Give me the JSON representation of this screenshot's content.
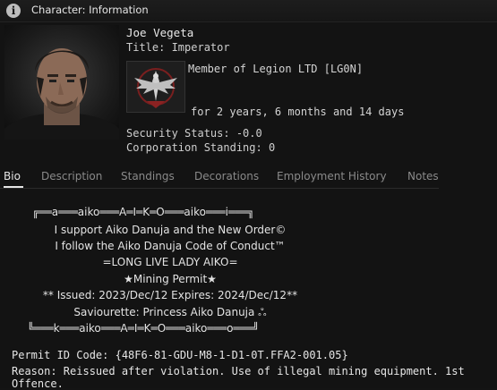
{
  "window": {
    "title": "Character: Information"
  },
  "character": {
    "name": "Joe Vegeta",
    "title": "Title: Imperator",
    "corp_member": "Member of Legion LTD [LG0N]",
    "corp_duration": "for 2 years, 6 months and 14 days",
    "security_status": "Security Status: -0.0",
    "corp_standing": "Corporation Standing: 0"
  },
  "tabs": [
    "Bio",
    "Description",
    "Standings",
    "Decorations",
    "Employment History",
    "Notes"
  ],
  "active_tab": "Bio",
  "bio": {
    "lines": [
      "╔══a═══aiko═══A═I═K═O═══aiko═══i═══╗",
      "I support Aiko Danuja and the New Order©",
      "I follow the Aiko Danuja Code of Conduct™",
      "=LONG LIVE LADY AIKO=",
      "★Mining Permit★",
      "** Issued: 2023/Dec/12 Expires: 2024/Dec/12**",
      "Saviourette: Princess Aiko Danuja ஃ",
      "╚═══k═══aiko═══A═I═K═O═══aiko═══o═══╝"
    ],
    "permit_id": "Permit ID Code: {48F6-81-GDU-M8-1-D1-0T.FFA2-001.05}",
    "reason": "Reason: Reissued after violation.  Use of illegal mining equipment. 1st Offence."
  },
  "colors": {
    "background": "#131313",
    "text": "#d6d6d6",
    "tab_inactive": "#8a8a8a",
    "tab_active": "#e6e6e6"
  },
  "icons": {
    "titlebar": "info-icon",
    "corp_logo": "eagle-emblem-icon"
  }
}
